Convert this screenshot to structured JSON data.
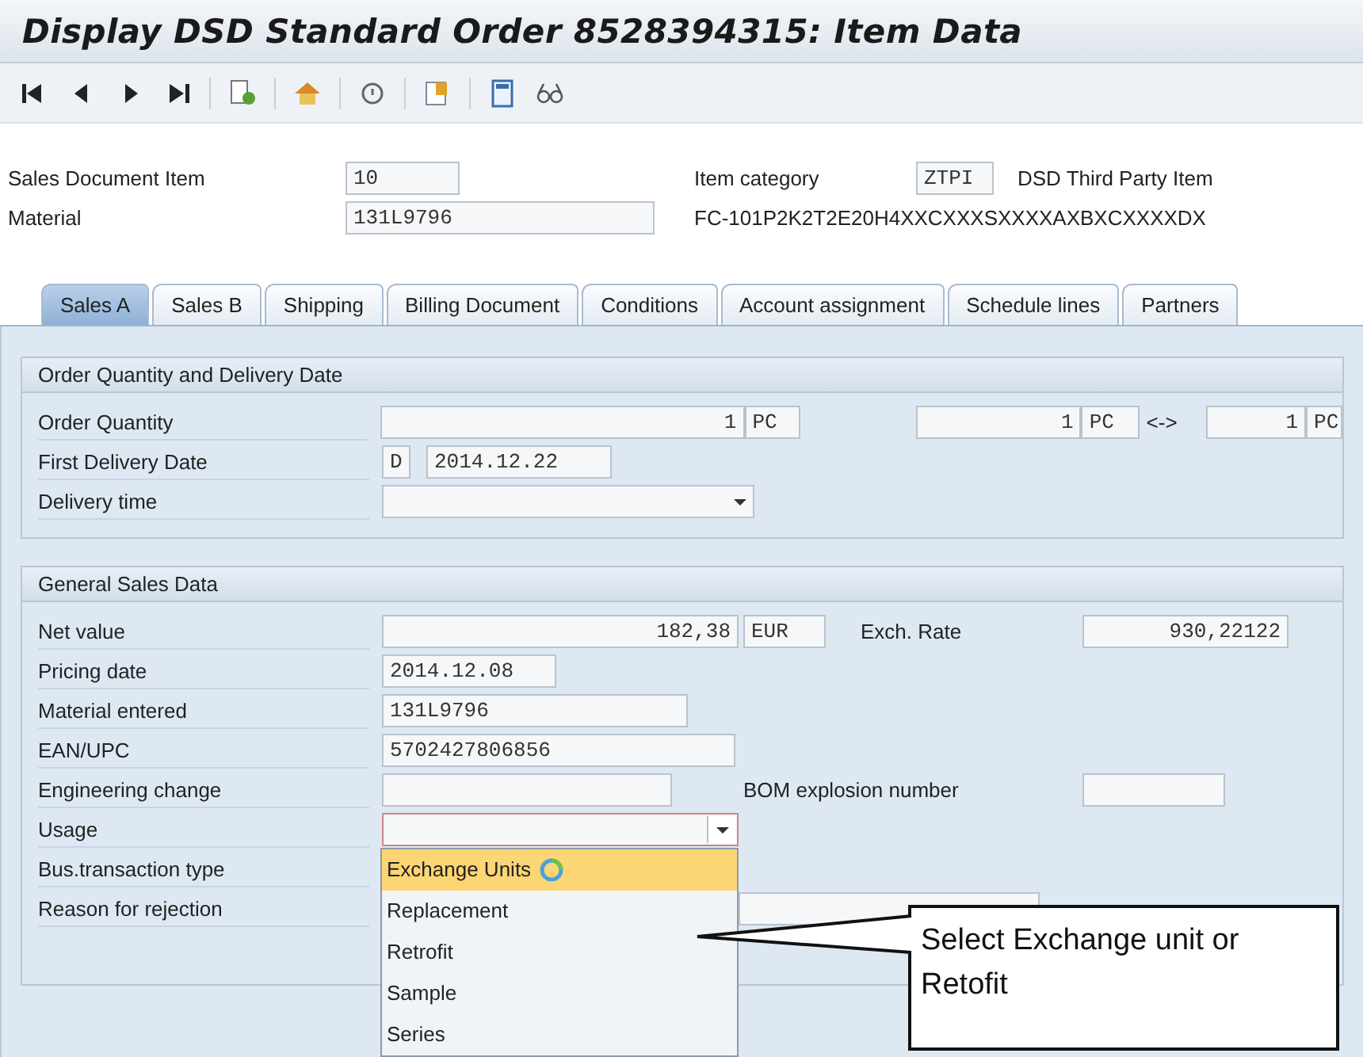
{
  "window": {
    "title": "Display DSD Standard Order 8528394315: Item Data"
  },
  "header": {
    "rows": [
      {
        "items": [
          {
            "kind": "label",
            "text": "Sales Document Item"
          },
          {
            "kind": "field",
            "value": "10"
          },
          {
            "kind": "label",
            "text": "Item category"
          },
          {
            "kind": "field",
            "value": "ZTPI"
          },
          {
            "kind": "text",
            "text": "DSD Third Party Item"
          }
        ]
      },
      {
        "items": [
          {
            "kind": "label",
            "text": "Material"
          },
          {
            "kind": "field",
            "value": "131L9796"
          },
          {
            "kind": "text",
            "text": "FC-101P2K2T2E20H4XXCXXXSXXXXAXBXCXXXXDX"
          }
        ]
      }
    ]
  },
  "tabs": [
    {
      "label": "Sales A",
      "selected": true
    },
    {
      "label": "Sales B",
      "selected": false
    },
    {
      "label": "Shipping",
      "selected": false
    },
    {
      "label": "Billing Document",
      "selected": false
    },
    {
      "label": "Conditions",
      "selected": false
    },
    {
      "label": "Account assignment",
      "selected": false
    },
    {
      "label": "Schedule lines",
      "selected": false
    },
    {
      "label": "Partners",
      "selected": false
    }
  ],
  "groups": [
    {
      "title": "Order Quantity and Delivery Date",
      "rows": [
        {
          "items": [
            {
              "kind": "label",
              "text": "Order Quantity"
            },
            {
              "kind": "number",
              "value": "1"
            },
            {
              "kind": "unit",
              "value": "PC"
            },
            {
              "kind": "number",
              "value": "1"
            },
            {
              "kind": "unit",
              "value": "PC"
            },
            {
              "kind": "text",
              "text": "<->"
            },
            {
              "kind": "number",
              "value": "1"
            },
            {
              "kind": "unit",
              "value": "PC"
            }
          ]
        },
        {
          "items": [
            {
              "kind": "label",
              "text": "First Delivery Date"
            },
            {
              "kind": "unit",
              "value": "D"
            },
            {
              "kind": "field",
              "value": "2014.12.22"
            }
          ]
        },
        {
          "items": [
            {
              "kind": "label",
              "text": "Delivery time"
            },
            {
              "kind": "dropdown",
              "value": "",
              "focused": false
            }
          ]
        }
      ]
    },
    {
      "title": "General Sales Data",
      "rows": [
        {
          "items": [
            {
              "kind": "label",
              "text": "Net value"
            },
            {
              "kind": "number",
              "value": "182,38"
            },
            {
              "kind": "unit",
              "value": "EUR"
            },
            {
              "kind": "text",
              "text": "Exch. Rate"
            },
            {
              "kind": "number",
              "value": "930,22122"
            }
          ]
        },
        {
          "items": [
            {
              "kind": "label",
              "text": "Pricing date"
            },
            {
              "kind": "field",
              "value": "2014.12.08"
            }
          ]
        },
        {
          "items": [
            {
              "kind": "label",
              "text": "Material entered"
            },
            {
              "kind": "field",
              "value": "131L9796"
            }
          ]
        },
        {
          "items": [
            {
              "kind": "label",
              "text": "EAN/UPC"
            },
            {
              "kind": "field",
              "value": "5702427806856"
            }
          ]
        },
        {
          "items": [
            {
              "kind": "label",
              "text": "Engineering change"
            },
            {
              "kind": "field",
              "value": ""
            },
            {
              "kind": "text",
              "text": "BOM explosion number"
            },
            {
              "kind": "field",
              "value": ""
            }
          ]
        },
        {
          "items": [
            {
              "kind": "label",
              "text": "Usage"
            },
            {
              "kind": "dropdown",
              "value": "",
              "focused": true
            }
          ]
        },
        {
          "items": [
            {
              "kind": "label",
              "text": "Bus.transaction type"
            }
          ]
        },
        {
          "items": [
            {
              "kind": "label",
              "text": "Reason for rejection"
            },
            {
              "kind": "field",
              "value": ""
            }
          ]
        }
      ]
    }
  ],
  "dropdown_list": {
    "items": [
      {
        "label": "Exchange Units",
        "selected": true
      },
      {
        "label": "Replacement",
        "selected": false
      },
      {
        "label": "Retrofit",
        "selected": false
      },
      {
        "label": "Sample",
        "selected": false
      },
      {
        "label": "Series",
        "selected": false
      }
    ]
  },
  "callout": {
    "text": "Select Exchange unit or Retofit"
  }
}
